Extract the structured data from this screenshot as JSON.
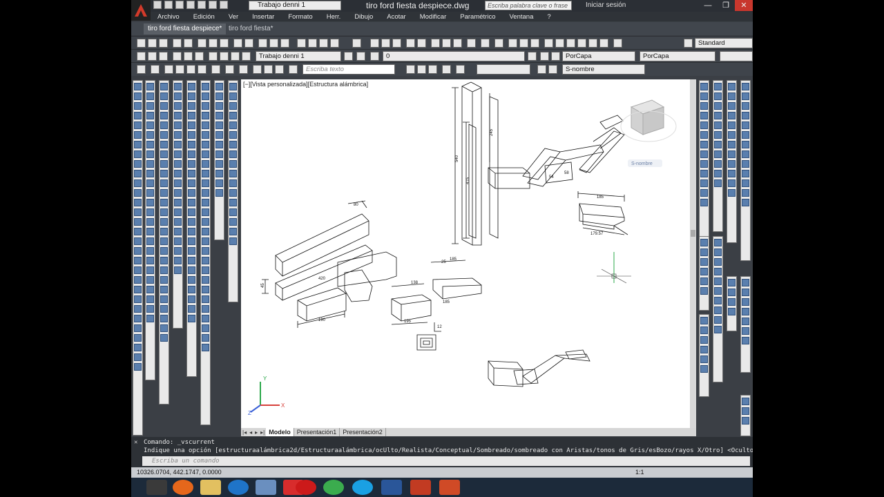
{
  "window": {
    "title": "tiro ford fiesta despiece.dwg",
    "workspace": "Trabajo denni 1",
    "search_placeholder": "Escriba palabra clave o frase",
    "signin": "Iniciar sesión"
  },
  "menu": [
    "Archivo",
    "Edición",
    "Ver",
    "Insertar",
    "Formato",
    "Herr.",
    "Dibujo",
    "Acotar",
    "Modificar",
    "Paramétrico",
    "Ventana",
    "?"
  ],
  "file_tabs": [
    "tiro ford fiesta despiece*",
    "tiro ford fiesta*"
  ],
  "toolbars": {
    "text_style": "Standard",
    "workspace": "Trabajo denni 1",
    "layer": "0",
    "color": "PorCapa",
    "linetype": "PorCapa",
    "text_placeholder": "Escriba texto",
    "dim_style": "S-nombre"
  },
  "viewport": {
    "label": "[−][Vista personalizada][Estructura alámbrica]",
    "viewcube_label": "S-nombre"
  },
  "layout_tabs": [
    "Modelo",
    "Presentación1",
    "Presentación2"
  ],
  "command": {
    "line1": "Comando:  _vscurrent",
    "line2": "Indique una opción [estructuraalámbrica2d/Estructuraalámbrica/ocUlto/Realista/Conceptual/Sombreado/sombreado con Aristas/tonos de Gris/esBozo/rayos X/Otro] <Oculto>: _W",
    "placeholder": "Escriba un comando"
  },
  "status": {
    "coords": "10326.0704, 442.1747, 0.0000",
    "scale": "1:1"
  },
  "dims": [
    "540",
    "415",
    "245",
    "185",
    "179.57",
    "58",
    "54",
    "80",
    "420",
    "45",
    "190",
    "138",
    "185",
    "185",
    "195",
    "12",
    "25"
  ],
  "taskbar": [
    "aplicación",
    "Firefox",
    "Explorador",
    "Internet Explorer",
    "Calculadora",
    "Opera",
    "Chrome",
    "Skype",
    "Word",
    "AutoCAD",
    "PowerPoint"
  ]
}
